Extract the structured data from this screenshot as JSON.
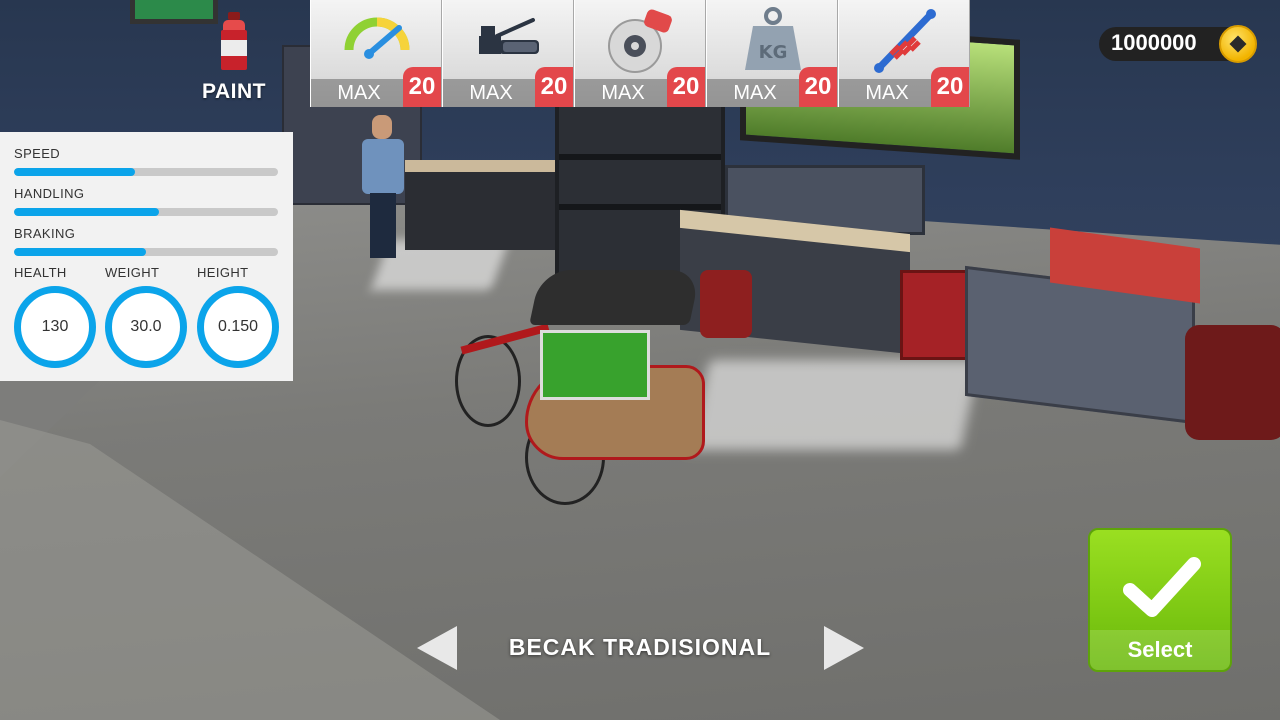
{
  "paint": {
    "label": "PAINT",
    "icon": "spray-paint-can-icon"
  },
  "upgrades": [
    {
      "icon": "speedometer-icon",
      "status": "MAX",
      "level": "20"
    },
    {
      "icon": "handlebar-grip-icon",
      "status": "MAX",
      "level": "20"
    },
    {
      "icon": "brake-disc-icon",
      "status": "MAX",
      "level": "20"
    },
    {
      "icon": "kg-weight-icon",
      "status": "MAX",
      "level": "20"
    },
    {
      "icon": "shock-absorber-icon",
      "status": "MAX",
      "level": "20"
    }
  ],
  "coins": {
    "amount": "1000000",
    "icon": "coin-icon"
  },
  "stats": {
    "bars": [
      {
        "label": "SPEED",
        "value": 0.46
      },
      {
        "label": "HANDLING",
        "value": 0.55
      },
      {
        "label": "BRAKING",
        "value": 0.5
      }
    ],
    "circles": [
      {
        "label": "HEALTH",
        "value": "130"
      },
      {
        "label": "WEIGHT",
        "value": "30.0"
      },
      {
        "label": "HEIGHT",
        "value": "0.150"
      }
    ]
  },
  "vehicle": {
    "name": "BECAK TRADISIONAL"
  },
  "select_button": {
    "label": "Select"
  },
  "colors": {
    "accent_blue": "#0ba4ea",
    "level_red": "#e3474b",
    "select_green": "#7ccd15"
  }
}
